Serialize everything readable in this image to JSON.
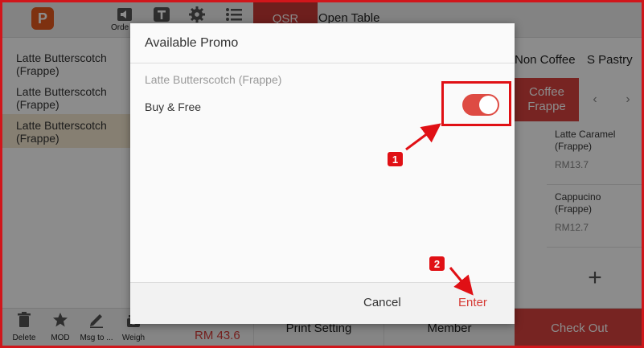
{
  "topbar": {
    "tools": [
      {
        "icon": "volume-icon",
        "label": "Orde"
      },
      {
        "icon": "text-icon",
        "label": ""
      },
      {
        "icon": "gear-icon",
        "label": ""
      },
      {
        "icon": "list-icon",
        "label": ""
      }
    ],
    "tabs": {
      "qsr": "QSR",
      "open_table": "Open Table"
    }
  },
  "order_list": [
    {
      "line1": "Latte Butterscotch",
      "line2": "(Frappe)"
    },
    {
      "line1": "Latte Butterscotch",
      "line2": "(Frappe)"
    },
    {
      "line1": "Latte Butterscotch",
      "line2": "(Frappe)"
    }
  ],
  "categories": {
    "non_coffee": "Non Coffee",
    "s_pastry": "S Pastry",
    "active_line1": "Coffee",
    "active_line2": "Frappe"
  },
  "products": [
    {
      "name_line1": "Latte Caramel",
      "name_line2": "(Frappe)",
      "price": "RM13.7"
    },
    {
      "name_line1": "Cappucino",
      "name_line2": "(Frappe)",
      "price": "RM12.7"
    }
  ],
  "bottom": {
    "tools": [
      {
        "icon": "trash-icon",
        "label": "Delete"
      },
      {
        "icon": "star-icon",
        "label": "MOD"
      },
      {
        "icon": "pen-icon",
        "label": "Msg to ..."
      },
      {
        "icon": "scale-icon",
        "label": "Weigh"
      }
    ],
    "total": "RM 43.6",
    "print_setting": "Print Setting",
    "member": "Member",
    "checkout": "Check Out"
  },
  "dialog": {
    "title": "Available Promo",
    "item_name": "Latte Butterscotch (Frappe)",
    "promo_label": "Buy & Free",
    "promo_enabled": true,
    "cancel": "Cancel",
    "enter": "Enter"
  },
  "annotations": {
    "step1": "1",
    "step2": "2",
    "color": "#e01015"
  },
  "colors": {
    "accent": "#d9433e",
    "selected_row": "#f5e8cf",
    "logo": "#e65a1e"
  }
}
